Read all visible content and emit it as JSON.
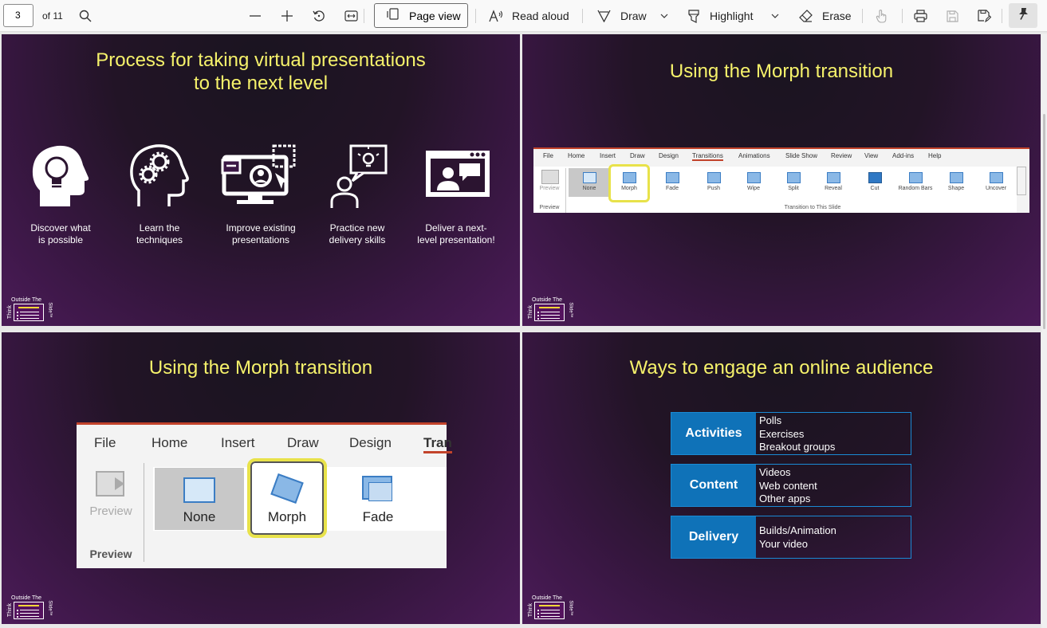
{
  "toolbar": {
    "page_number": "3",
    "page_total": "of 11",
    "page_view_label": "Page view",
    "read_aloud_label": "Read aloud",
    "draw_label": "Draw",
    "highlight_label": "Highlight",
    "erase_label": "Erase",
    "icons": [
      "search-icon",
      "zoom-out-icon",
      "zoom-in-icon",
      "rotate-icon",
      "fit-width-icon",
      "page-view-icon",
      "read-aloud-icon",
      "draw-icon",
      "chevron-down-icon",
      "highlight-icon",
      "eraser-icon",
      "touch-icon",
      "print-icon",
      "save-icon",
      "save-as-icon",
      "pin-icon"
    ]
  },
  "slides": {
    "s1": {
      "title_line1": "Process for taking virtual presentations",
      "title_line2": "to the next level",
      "steps": [
        {
          "l1": "Discover what",
          "l2": "is possible"
        },
        {
          "l1": "Learn the",
          "l2": "techniques"
        },
        {
          "l1": "Improve existing",
          "l2": "presentations"
        },
        {
          "l1": "Practice new",
          "l2": "delivery skills"
        },
        {
          "l1": "Deliver a next-",
          "l2": "level presentation!"
        }
      ]
    },
    "s2": {
      "title": "Using the Morph transition",
      "ribbon_tabs": [
        "File",
        "Home",
        "Insert",
        "Draw",
        "Design",
        "Transitions",
        "Animations",
        "Slide Show",
        "Review",
        "View",
        "Add-ins",
        "Help"
      ],
      "preview_label": "Preview",
      "preview_group": "Preview",
      "items": [
        "None",
        "Morph",
        "Fade",
        "Push",
        "Wipe",
        "Split",
        "Reveal",
        "Cut",
        "Random Bars",
        "Shape",
        "Uncover"
      ],
      "group_label": "Transition to This Slide"
    },
    "s3": {
      "title": "Using the Morph transition",
      "ribbon_tabs": [
        "File",
        "Home",
        "Insert",
        "Draw",
        "Design",
        "Tran"
      ],
      "preview_label": "Preview",
      "preview_group": "Preview",
      "items": [
        "None",
        "Morph",
        "Fade"
      ]
    },
    "s4": {
      "title": "Ways to engage an online audience",
      "rows": [
        {
          "label": "Activities",
          "items": [
            "Polls",
            "Exercises",
            "Breakout groups"
          ]
        },
        {
          "label": "Content",
          "items": [
            "Videos",
            "Web content",
            "Other apps"
          ]
        },
        {
          "label": "Delivery",
          "items": [
            "Builds/Animation",
            "Your video"
          ]
        }
      ]
    },
    "logo": {
      "top": "Outside The",
      "left": "Think",
      "right": "Slide™"
    }
  },
  "colors": {
    "title": "#f6f26b",
    "accent": "#0f72b8",
    "morph_highlight": "#e8e24a"
  }
}
